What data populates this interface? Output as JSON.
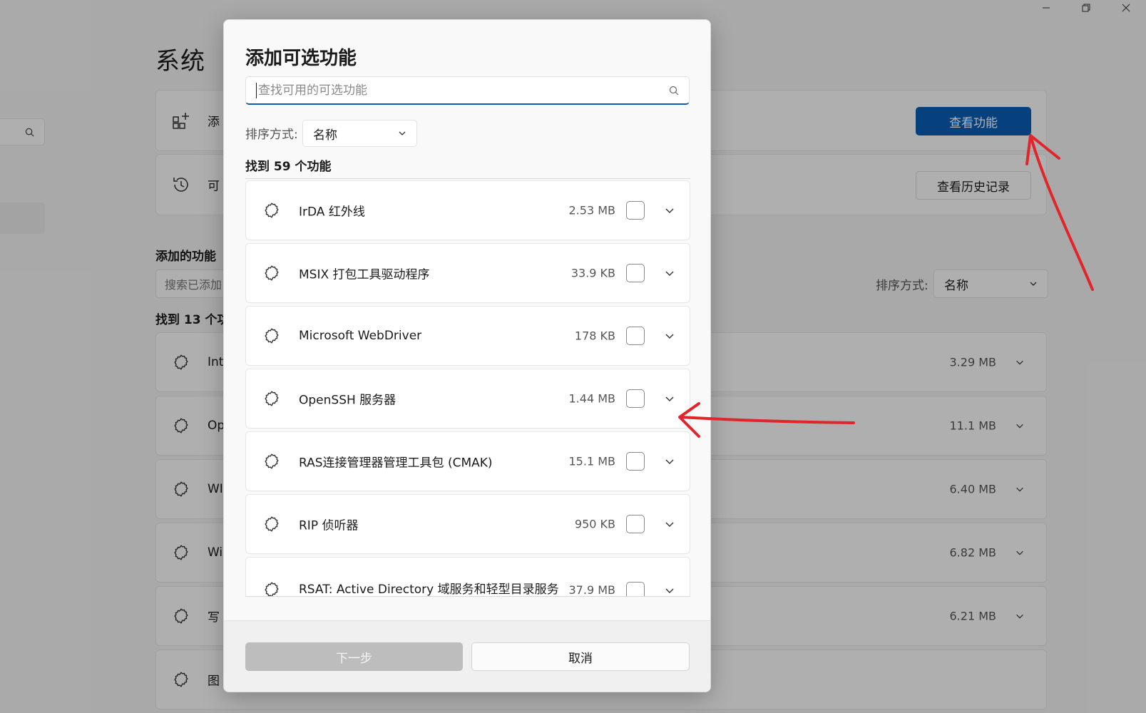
{
  "background": {
    "page_title": "系统",
    "cards": [
      {
        "label": "添",
        "icon": "add-apps-icon"
      },
      {
        "label": "可",
        "icon": "history-icon"
      }
    ],
    "view_features_button": "查看功能",
    "view_history_button": "查看历史记录",
    "added_section_title": "添加的功能",
    "search_added_placeholder": "搜索已添加",
    "sort_label": "排序方式:",
    "sort_value": "名称",
    "found_count": "找到 13 个功",
    "installed": [
      {
        "label": "Int",
        "size": "3.29 MB"
      },
      {
        "label": "Op",
        "size": "11.1 MB"
      },
      {
        "label": "WI",
        "size": "6.40 MB"
      },
      {
        "label": "Wi",
        "size": "6.82 MB"
      },
      {
        "label": "写",
        "size": "6.21 MB"
      },
      {
        "label": "图",
        "size": ""
      }
    ]
  },
  "dialog": {
    "title": "添加可选功能",
    "search_placeholder": "查找可用的可选功能",
    "sort_label": "排序方式:",
    "sort_value": "名称",
    "found_count": "找到 59 个功能",
    "features": [
      {
        "name": "IrDA 红外线",
        "size": "2.53 MB"
      },
      {
        "name": "MSIX 打包工具驱动程序",
        "size": "33.9 KB"
      },
      {
        "name": "Microsoft WebDriver",
        "size": "178 KB"
      },
      {
        "name": "OpenSSH 服务器",
        "size": "1.44 MB"
      },
      {
        "name": "RAS连接管理器管理工具包 (CMAK)",
        "size": "15.1 MB"
      },
      {
        "name": "RIP 侦听器",
        "size": "950 KB"
      },
      {
        "name": "RSAT: Active Directory 域服务和轻型目录服务",
        "size": "37.9 MB"
      }
    ],
    "next_button": "下一步",
    "cancel_button": "取消"
  },
  "colors": {
    "accent": "#0a5cb4",
    "annotation": "#e0262b"
  }
}
